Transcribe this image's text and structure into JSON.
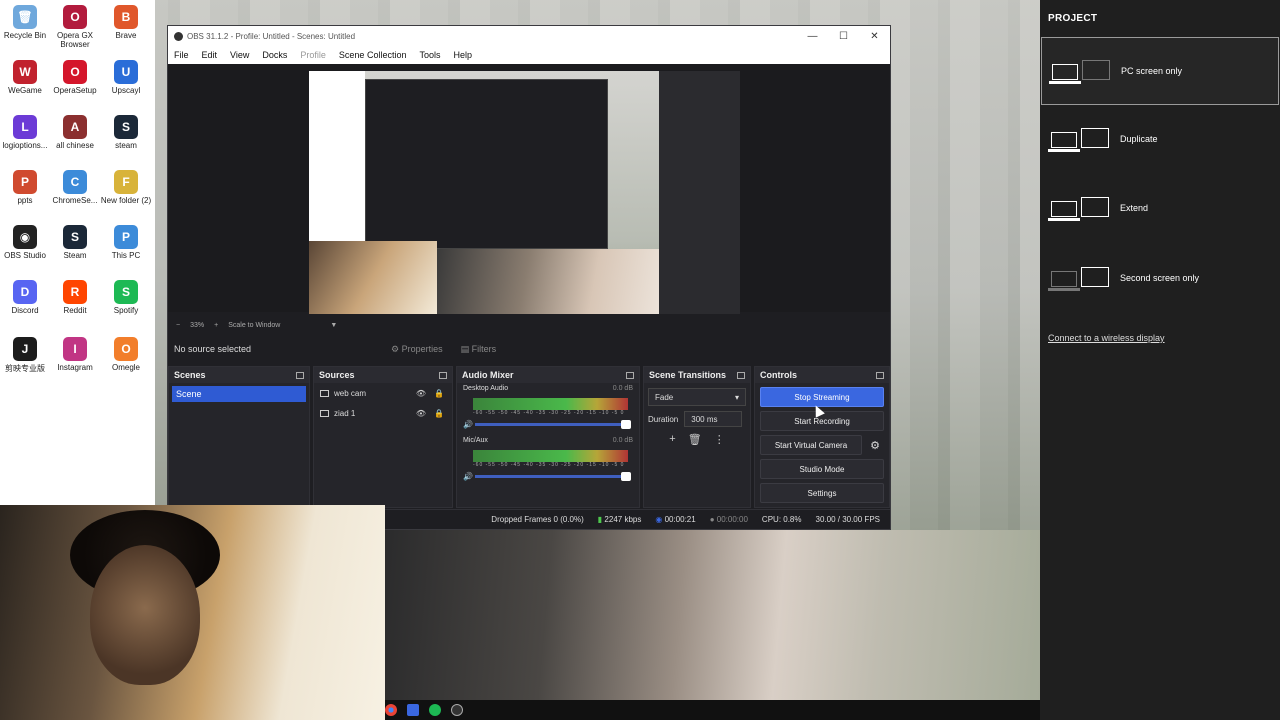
{
  "desktop": {
    "icons": [
      {
        "label": "Recycle Bin",
        "color": "#6fa8dc",
        "glyph": "🗑"
      },
      {
        "label": "Opera GX Browser",
        "color": "#b21b3d",
        "glyph": "O"
      },
      {
        "label": "Brave",
        "color": "#e0572b",
        "glyph": "B"
      },
      {
        "label": "WeGame",
        "color": "#c1222e",
        "glyph": "W"
      },
      {
        "label": "OperaSetup",
        "color": "#d4162b",
        "glyph": "O"
      },
      {
        "label": "Upscayl",
        "color": "#2a6dd8",
        "glyph": "U"
      },
      {
        "label": "logioptions...",
        "color": "#6c3bd6",
        "glyph": "L"
      },
      {
        "label": "all chinese",
        "color": "#8b2f2f",
        "glyph": "A"
      },
      {
        "label": "steam",
        "color": "#1b2838",
        "glyph": "S"
      },
      {
        "label": "ppts",
        "color": "#d04a2f",
        "glyph": "P"
      },
      {
        "label": "ChromeSe...",
        "color": "#3c8bd9",
        "glyph": "C"
      },
      {
        "label": "New folder (2)",
        "color": "#d8b33a",
        "glyph": "F"
      },
      {
        "label": "OBS Studio",
        "color": "#222222",
        "glyph": "◉"
      },
      {
        "label": "Steam",
        "color": "#1b2838",
        "glyph": "S"
      },
      {
        "label": "This PC",
        "color": "#3c8bd9",
        "glyph": "P"
      },
      {
        "label": "Discord",
        "color": "#5865f2",
        "glyph": "D"
      },
      {
        "label": "Reddit",
        "color": "#ff4500",
        "glyph": "R"
      },
      {
        "label": "Spotify",
        "color": "#1db954",
        "glyph": "S"
      },
      {
        "label": "剪映专业版",
        "color": "#1c1c1c",
        "glyph": "J"
      },
      {
        "label": "Instagram",
        "color": "#c13584",
        "glyph": "I"
      },
      {
        "label": "Omegle",
        "color": "#f27e2b",
        "glyph": "O"
      }
    ]
  },
  "obs": {
    "title": "OBS 31.1.2 - Profile: Untitled - Scenes: Untitled",
    "window_controls": [
      "—",
      "☐",
      "✕"
    ],
    "menu": [
      "File",
      "Edit",
      "View",
      "Docks",
      "Profile",
      "Scene Collection",
      "Tools",
      "Help"
    ],
    "preview_toolbar": {
      "zoom": "33%",
      "scale_label": "Scale to Window"
    },
    "no_source": "No source selected",
    "properties_label": "Properties",
    "filters_label": "Filters",
    "scenes": {
      "title": "Scenes",
      "items": [
        "Scene"
      ]
    },
    "sources": {
      "title": "Sources",
      "items": [
        "web cam",
        "ziad 1"
      ]
    },
    "mixer": {
      "title": "Audio Mixer",
      "channels": [
        {
          "name": "Desktop Audio",
          "db": "0.0 dB"
        },
        {
          "name": "Mic/Aux",
          "db": "0.0 dB"
        }
      ],
      "scale": "-60 -55 -50 -45 -40 -35 -30 -25 -20 -15 -10 -5 0"
    },
    "transitions": {
      "title": "Scene Transitions",
      "selected": "Fade",
      "duration_label": "Duration",
      "duration_value": "300 ms"
    },
    "controls": {
      "title": "Controls",
      "stop_streaming": "Stop Streaming",
      "start_recording": "Start Recording",
      "start_virtual_camera": "Start Virtual Camera",
      "studio_mode": "Studio Mode",
      "settings": "Settings"
    },
    "statusbar": {
      "dropped": "Dropped Frames 0 (0.0%)",
      "bitrate": "2247 kbps",
      "stream_time": "00:00:21",
      "record_time": "00:00:00",
      "cpu": "CPU: 0.8%",
      "fps": "30.00 / 30.00 FPS"
    }
  },
  "project": {
    "title": "PROJECT",
    "options": [
      "PC screen only",
      "Duplicate",
      "Extend",
      "Second screen only"
    ],
    "selected": "PC screen only",
    "connect_link": "Connect to a wireless display"
  },
  "colors": {
    "accent": "#3a67e0",
    "panel_bg": "#25252a",
    "project_bg": "#1f1f1f"
  }
}
